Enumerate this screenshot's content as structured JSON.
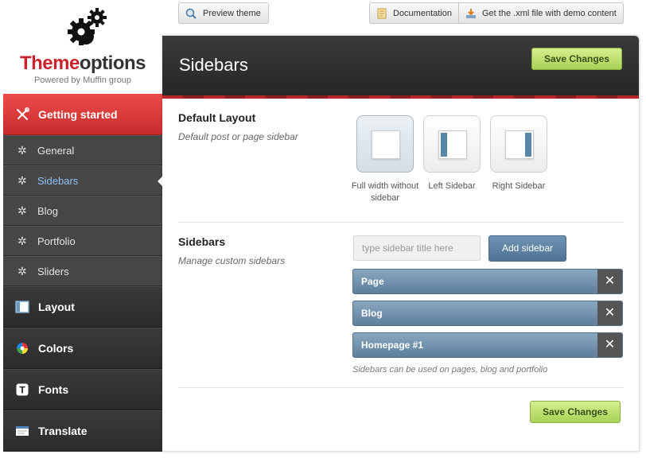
{
  "logo": {
    "title_part1": "Theme",
    "title_part2": "options",
    "subtitle": "Powered by Muffin group"
  },
  "topbar": {
    "preview_label": "Preview theme",
    "documentation_label": "Documentation",
    "xml_label": "Get the .xml file with demo content"
  },
  "nav": {
    "top": {
      "label": "Getting started",
      "icon": "tools-icon"
    },
    "subitems": [
      {
        "label": "General",
        "icon": "gear-icon",
        "active": false
      },
      {
        "label": "Sidebars",
        "icon": "gear-icon",
        "active": true
      },
      {
        "label": "Blog",
        "icon": "gear-icon",
        "active": false
      },
      {
        "label": "Portfolio",
        "icon": "gear-icon",
        "active": false
      },
      {
        "label": "Sliders",
        "icon": "gear-icon",
        "active": false
      }
    ],
    "main": [
      {
        "label": "Layout",
        "icon": "layout-icon"
      },
      {
        "label": "Colors",
        "icon": "color-wheel-icon"
      },
      {
        "label": "Fonts",
        "icon": "font-icon"
      },
      {
        "label": "Translate",
        "icon": "translate-icon"
      }
    ]
  },
  "panel": {
    "title": "Sidebars",
    "save_label": "Save Changes"
  },
  "default_layout": {
    "title": "Default Layout",
    "desc": "Default post or page sidebar",
    "options": [
      {
        "label": "Full width without sidebar",
        "selected": true
      },
      {
        "label": "Left Sidebar",
        "selected": false
      },
      {
        "label": "Right Sidebar",
        "selected": false
      }
    ]
  },
  "sidebars": {
    "title": "Sidebars",
    "desc": "Manage custom sidebars",
    "input_placeholder": "type sidebar title here",
    "input_value": "",
    "add_label": "Add sidebar",
    "items": [
      "Page",
      "Blog",
      "Homepage #1"
    ],
    "remove_glyph": "✕",
    "note": "Sidebars can be used on pages, blog and portfolio"
  },
  "colors": {
    "accent_red": "#c9242b",
    "save_green": "#a9d156",
    "sidebar_blue": "#5d7f9d",
    "active_nav_text": "#8ec2f5"
  }
}
